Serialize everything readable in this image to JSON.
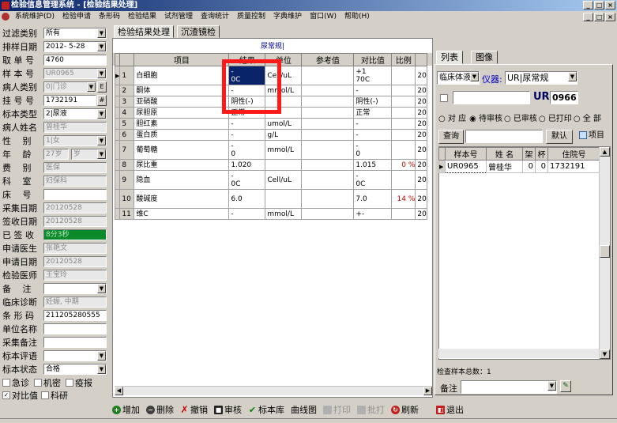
{
  "app": {
    "title": "检验信息管理系统 - [检验结果处理]"
  },
  "menu": [
    "系统维护(D)",
    "检验申请",
    "条形码",
    "检验结果",
    "试剂管理",
    "查询统计",
    "质量控制",
    "字典维护",
    "窗口(W)",
    "帮助(H)"
  ],
  "left": {
    "filter_type": {
      "label": "过滤类别",
      "value": "所有"
    },
    "sort_date": {
      "label": "排样日期",
      "value": "2012- 5-28"
    },
    "fetch_no": {
      "label": "取 单 号",
      "value": "4760"
    },
    "sample_no": {
      "label": "样 本 号",
      "value": "UR0965"
    },
    "patient_type": {
      "label": "病人类别",
      "value": "0|门诊"
    },
    "reg_no": {
      "label": "挂 号 号",
      "value": "1732191",
      "btn": "#"
    },
    "specimen_type": {
      "label": "标本类型",
      "value": "2|尿液"
    },
    "patient_name": {
      "label": "病人姓名",
      "value": "曾桂华"
    },
    "gender": {
      "label": "性　 别",
      "value": "1|女"
    },
    "age": {
      "label": "年　 龄",
      "value": "27岁",
      "unit": "岁"
    },
    "fee_type": {
      "label": "费　 别",
      "value": "医保"
    },
    "department": {
      "label": "科　 室",
      "value": "妇保科"
    },
    "bed_no": {
      "label": "床　 号",
      "value": ""
    },
    "collect_date": {
      "label": "采集日期",
      "value": "20120528"
    },
    "receive_date": {
      "label": "签收日期",
      "value": "20120528"
    },
    "signed": {
      "label": "已 签 收",
      "value": "8分3秒"
    },
    "request_doctor": {
      "label": "申请医生",
      "value": "张艳文"
    },
    "request_date": {
      "label": "申请日期",
      "value": "20120528"
    },
    "lab_doctor": {
      "label": "检验医师",
      "value": "王宝玲"
    },
    "remark": {
      "label": "备　 注",
      "value": ""
    },
    "diagnosis": {
      "label": "临床诊断",
      "value": "妊娠, 中期"
    },
    "barcode": {
      "label": "条 形 码",
      "value": "211205280555"
    },
    "unit_name": {
      "label": "单位名称",
      "value": ""
    },
    "collect_remark": {
      "label": "采集备注",
      "value": ""
    },
    "specimen_eval": {
      "label": "标本评语",
      "value": ""
    },
    "specimen_state": {
      "label": "标本状态",
      "value": "合格"
    },
    "checks": {
      "urgent": "急诊",
      "confidential": "机密",
      "epidemic": "疫报",
      "compare": "对比值",
      "research": "科研"
    }
  },
  "tabs": [
    "检验结果处理",
    "沉渣镜检"
  ],
  "grid": {
    "title": "尿常规|",
    "headers": [
      "项目",
      "结果",
      "单位",
      "参考值",
      "对比值",
      "比例"
    ],
    "rows": [
      {
        "no": "1",
        "name": "白细胞",
        "result": "-\n0C",
        "unit": "Cell/uL",
        "ref": "",
        "cmp": "+1\n70C",
        "ratio": "",
        "extra": "20",
        "marker": "▶"
      },
      {
        "no": "2",
        "name": "酮体",
        "result": "-",
        "unit": "mmol/L",
        "ref": "",
        "cmp": "-",
        "ratio": "",
        "extra": "20",
        "marker": ""
      },
      {
        "no": "3",
        "name": "亚硝酸",
        "result": "阴性(-)",
        "unit": "",
        "ref": "",
        "cmp": "阴性(-)",
        "ratio": "",
        "extra": "20",
        "marker": ""
      },
      {
        "no": "4",
        "name": "尿胆原",
        "result": "正常",
        "unit": "",
        "ref": "",
        "cmp": "正常",
        "ratio": "",
        "extra": "20",
        "marker": ""
      },
      {
        "no": "5",
        "name": "胆红素",
        "result": "-",
        "unit": "umol/L",
        "ref": "",
        "cmp": "-",
        "ratio": "",
        "extra": "20",
        "marker": ""
      },
      {
        "no": "6",
        "name": "蛋白质",
        "result": "-",
        "unit": "g/L",
        "ref": "",
        "cmp": "-",
        "ratio": "",
        "extra": "20",
        "marker": ""
      },
      {
        "no": "7",
        "name": "葡萄糖",
        "result": "-\n0",
        "unit": "mmol/L",
        "ref": "",
        "cmp": "-\n0",
        "ratio": "",
        "extra": "20",
        "marker": ""
      },
      {
        "no": "8",
        "name": "尿比重",
        "result": "1.020",
        "unit": "",
        "ref": "",
        "cmp": "1.015",
        "ratio": "0 %",
        "extra": "20",
        "marker": ""
      },
      {
        "no": "9",
        "name": "隐血",
        "result": "-\n0C",
        "unit": "Cell/uL",
        "ref": "",
        "cmp": "-\n0C",
        "ratio": "",
        "extra": "20",
        "marker": ""
      },
      {
        "no": "10",
        "name": "酸碱度",
        "result": "6.0",
        "unit": "",
        "ref": "",
        "cmp": "7.0",
        "ratio": "14 %",
        "extra": "20",
        "marker": ""
      },
      {
        "no": "11",
        "name": "维C",
        "result": "-",
        "unit": "mmol/L",
        "ref": "",
        "cmp": "+-",
        "ratio": "",
        "extra": "20",
        "marker": ""
      }
    ]
  },
  "right": {
    "tabs": [
      "列表",
      "图像"
    ],
    "instrument_type": "临床体液",
    "instrument_label": "仪器:",
    "instrument_value": "UR|尿常规",
    "ur_prefix": "UR",
    "ur_value": "0966",
    "radios": [
      "对 应",
      "待审核",
      "已审核",
      "已打印",
      "全 部"
    ],
    "query_btn": "查询",
    "default_btn": "默认",
    "item_btn": "项目",
    "list_headers": [
      "样本号",
      "姓 名",
      "架",
      "杯",
      "住院号"
    ],
    "list_rows": [
      {
        "sample": "UR0965",
        "name": "曾桂华",
        "rack": "0",
        "cup": "0",
        "inpatient": "1732191"
      }
    ],
    "total_label": "检查样本总数：1",
    "remark_label": "备注"
  },
  "toolbar": [
    "增加",
    "删除",
    "撤销",
    "审核",
    "标本库",
    "曲线图",
    "打印",
    "批打",
    "刷新",
    "退出"
  ],
  "colors": {
    "title_start": "#0a246a",
    "highlight": "#ff1a1a",
    "signed_bg": "#0a8a2a"
  }
}
